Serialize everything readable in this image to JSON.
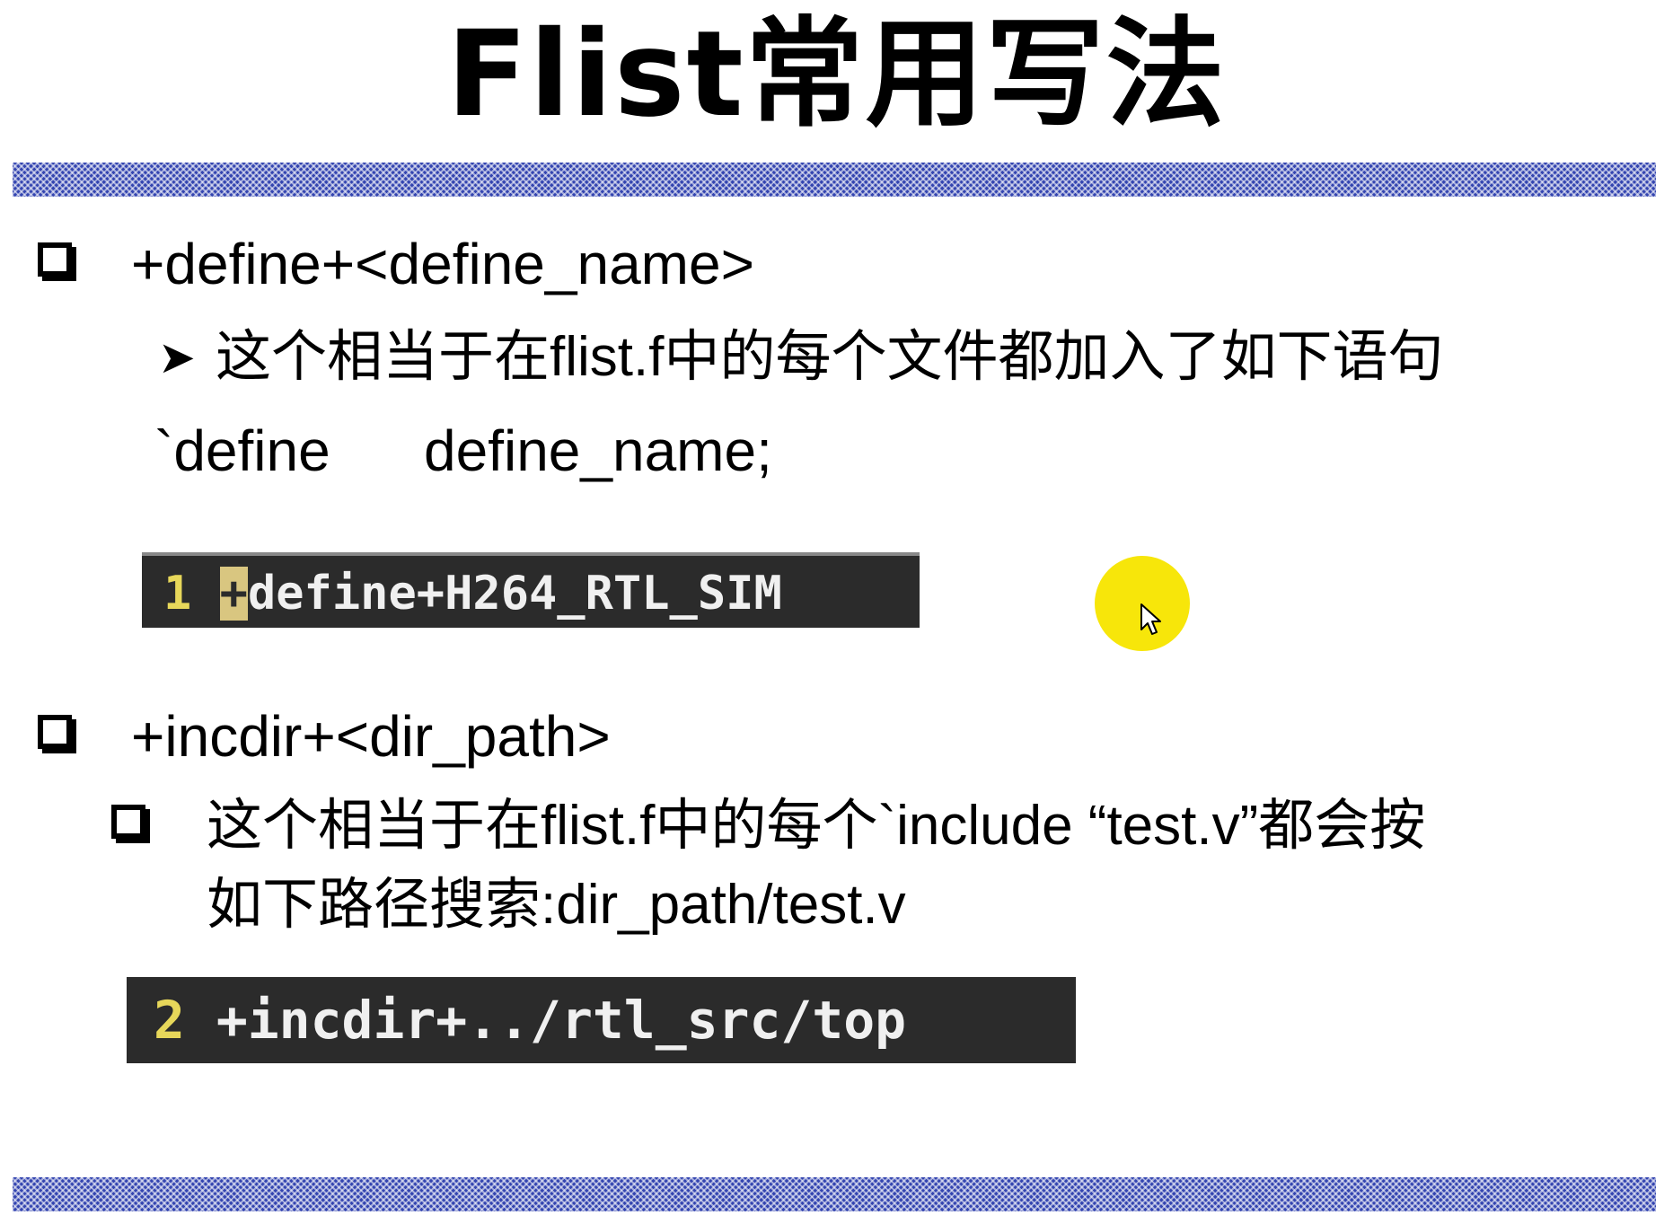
{
  "slide": {
    "title": "Flist常用写法",
    "sections": [
      {
        "heading": "+define+<define_name>",
        "desc": "这个相当于在flist.f中的每个文件都加入了如下语句",
        "snippet_keyword": "`define",
        "snippet_name": "define_name;",
        "code_line_number": "1",
        "code_cursor_char": "+",
        "code_text": "define+H264_RTL_SIM"
      },
      {
        "heading": "+incdir+<dir_path>",
        "desc_line1": "这个相当于在flist.f中的每个`include “test.v”都会按",
        "desc_line2": "如下路径搜索:dir_path/test.v",
        "code_line_number": "2",
        "code_text": "+incdir+../rtl_src/top"
      }
    ]
  },
  "colors": {
    "band": "#3344b0",
    "code_bg": "#2b2b2b",
    "code_text": "#f0f0f0",
    "line_number": "#e7d75a",
    "cursor_bg": "#d9c680",
    "pointer_highlight": "#f7e60a"
  },
  "icons": {
    "bullet": "checkbox-square-icon",
    "sub_bullet": "arrow-right-icon",
    "pointer": "mouse-cursor-icon"
  }
}
